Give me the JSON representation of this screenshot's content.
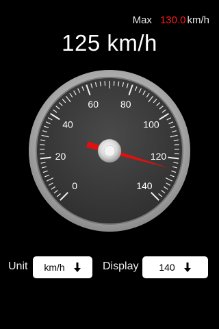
{
  "max": {
    "label": "Max",
    "value": "130.0",
    "unit": "km/h"
  },
  "speed_readout": "125 km/h",
  "gauge": {
    "value": 125,
    "min": 0,
    "max": 140,
    "tick_labels": [
      "0",
      "20",
      "40",
      "60",
      "80",
      "100",
      "120",
      "140"
    ],
    "needle_color": "#e01010"
  },
  "controls": {
    "unit_label": "Unit",
    "unit_value": "km/h",
    "display_label": "Display",
    "display_value": "140",
    "arrow_icon": "arrow-down-icon"
  },
  "colors": {
    "background": "#000000",
    "max_value": "#ff1a1a"
  }
}
